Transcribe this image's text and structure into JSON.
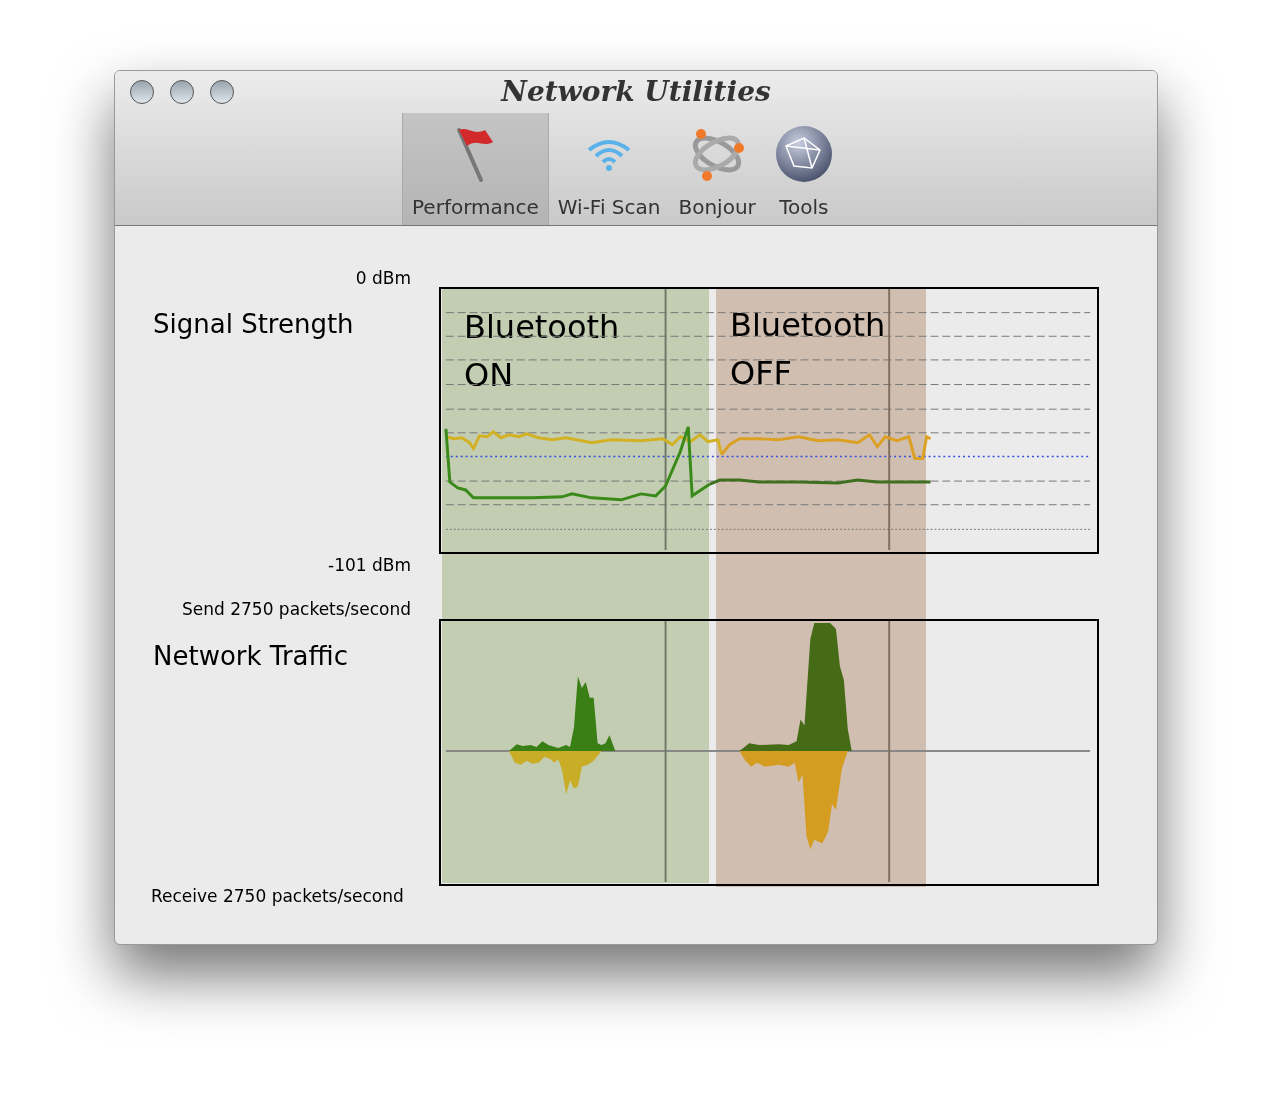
{
  "window": {
    "title": "Network Utilities"
  },
  "toolbar": [
    {
      "label": "Performance",
      "selected": true,
      "kind": "flag"
    },
    {
      "label": "Wi-Fi Scan",
      "selected": false,
      "kind": "wifi"
    },
    {
      "label": "Bonjour",
      "selected": false,
      "kind": "bonjour"
    },
    {
      "label": "Tools",
      "selected": false,
      "kind": "globe"
    }
  ],
  "signal": {
    "label": "Signal Strength",
    "top_reading": "0 dBm",
    "bottom_reading": "-101 dBm"
  },
  "traffic": {
    "label": "Network Traffic",
    "send_reading": "Send 2750 packets/second",
    "receive_reading": "Receive 2750 packets/second"
  },
  "overlays": [
    {
      "line1": "Bluetooth",
      "line2": "ON",
      "color": "#c2cdb1"
    },
    {
      "line1": "Bluetooth",
      "line2": "OFF",
      "color": "#d0bfb0"
    }
  ]
}
